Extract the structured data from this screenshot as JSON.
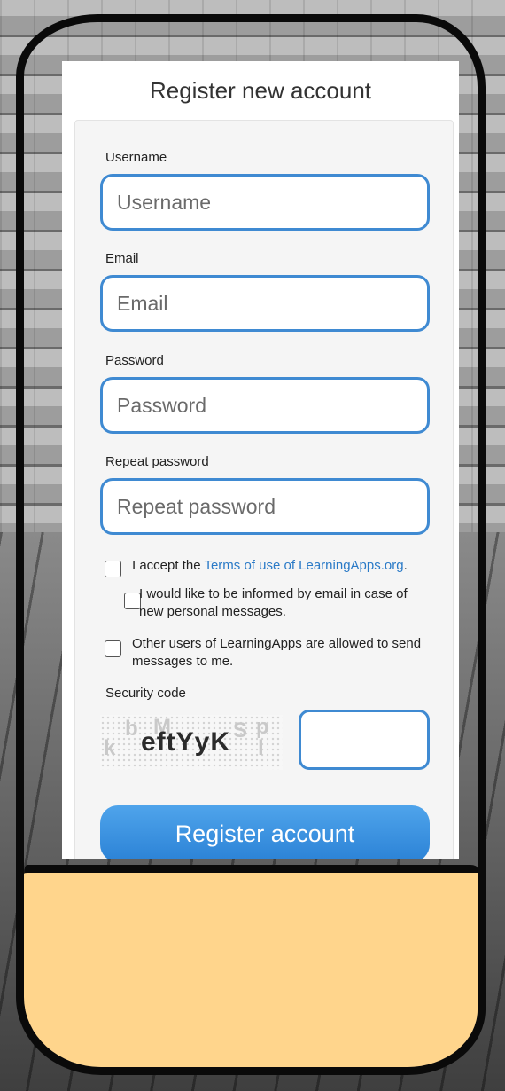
{
  "page": {
    "title": "Register new account"
  },
  "fields": [
    {
      "label": "Username",
      "placeholder": "Username"
    },
    {
      "label": "Email",
      "placeholder": "Email"
    },
    {
      "label": "Password",
      "placeholder": "Password"
    },
    {
      "label": "Repeat password",
      "placeholder": "Repeat password"
    }
  ],
  "checkboxes": {
    "terms": {
      "text_before": "I accept the ",
      "link": "Terms of use of LearningApps.org",
      "text_after": ".",
      "checked": false
    },
    "notify": {
      "text": "I would like to be informed by email in case of new personal messages.",
      "checked": false
    },
    "messages": {
      "text": "Other users of LearningApps are allowed to send messages to me.",
      "checked": false
    }
  },
  "security": {
    "label": "Security code",
    "captcha_text": "eftYyK",
    "value": ""
  },
  "register_button": {
    "label": "Register account"
  },
  "colors": {
    "accent": "#3f8ad2",
    "button": "#2b82d6",
    "link": "#2a7ac7",
    "bottom_panel": "#ffd58c",
    "frame": "#0a0a0a"
  }
}
